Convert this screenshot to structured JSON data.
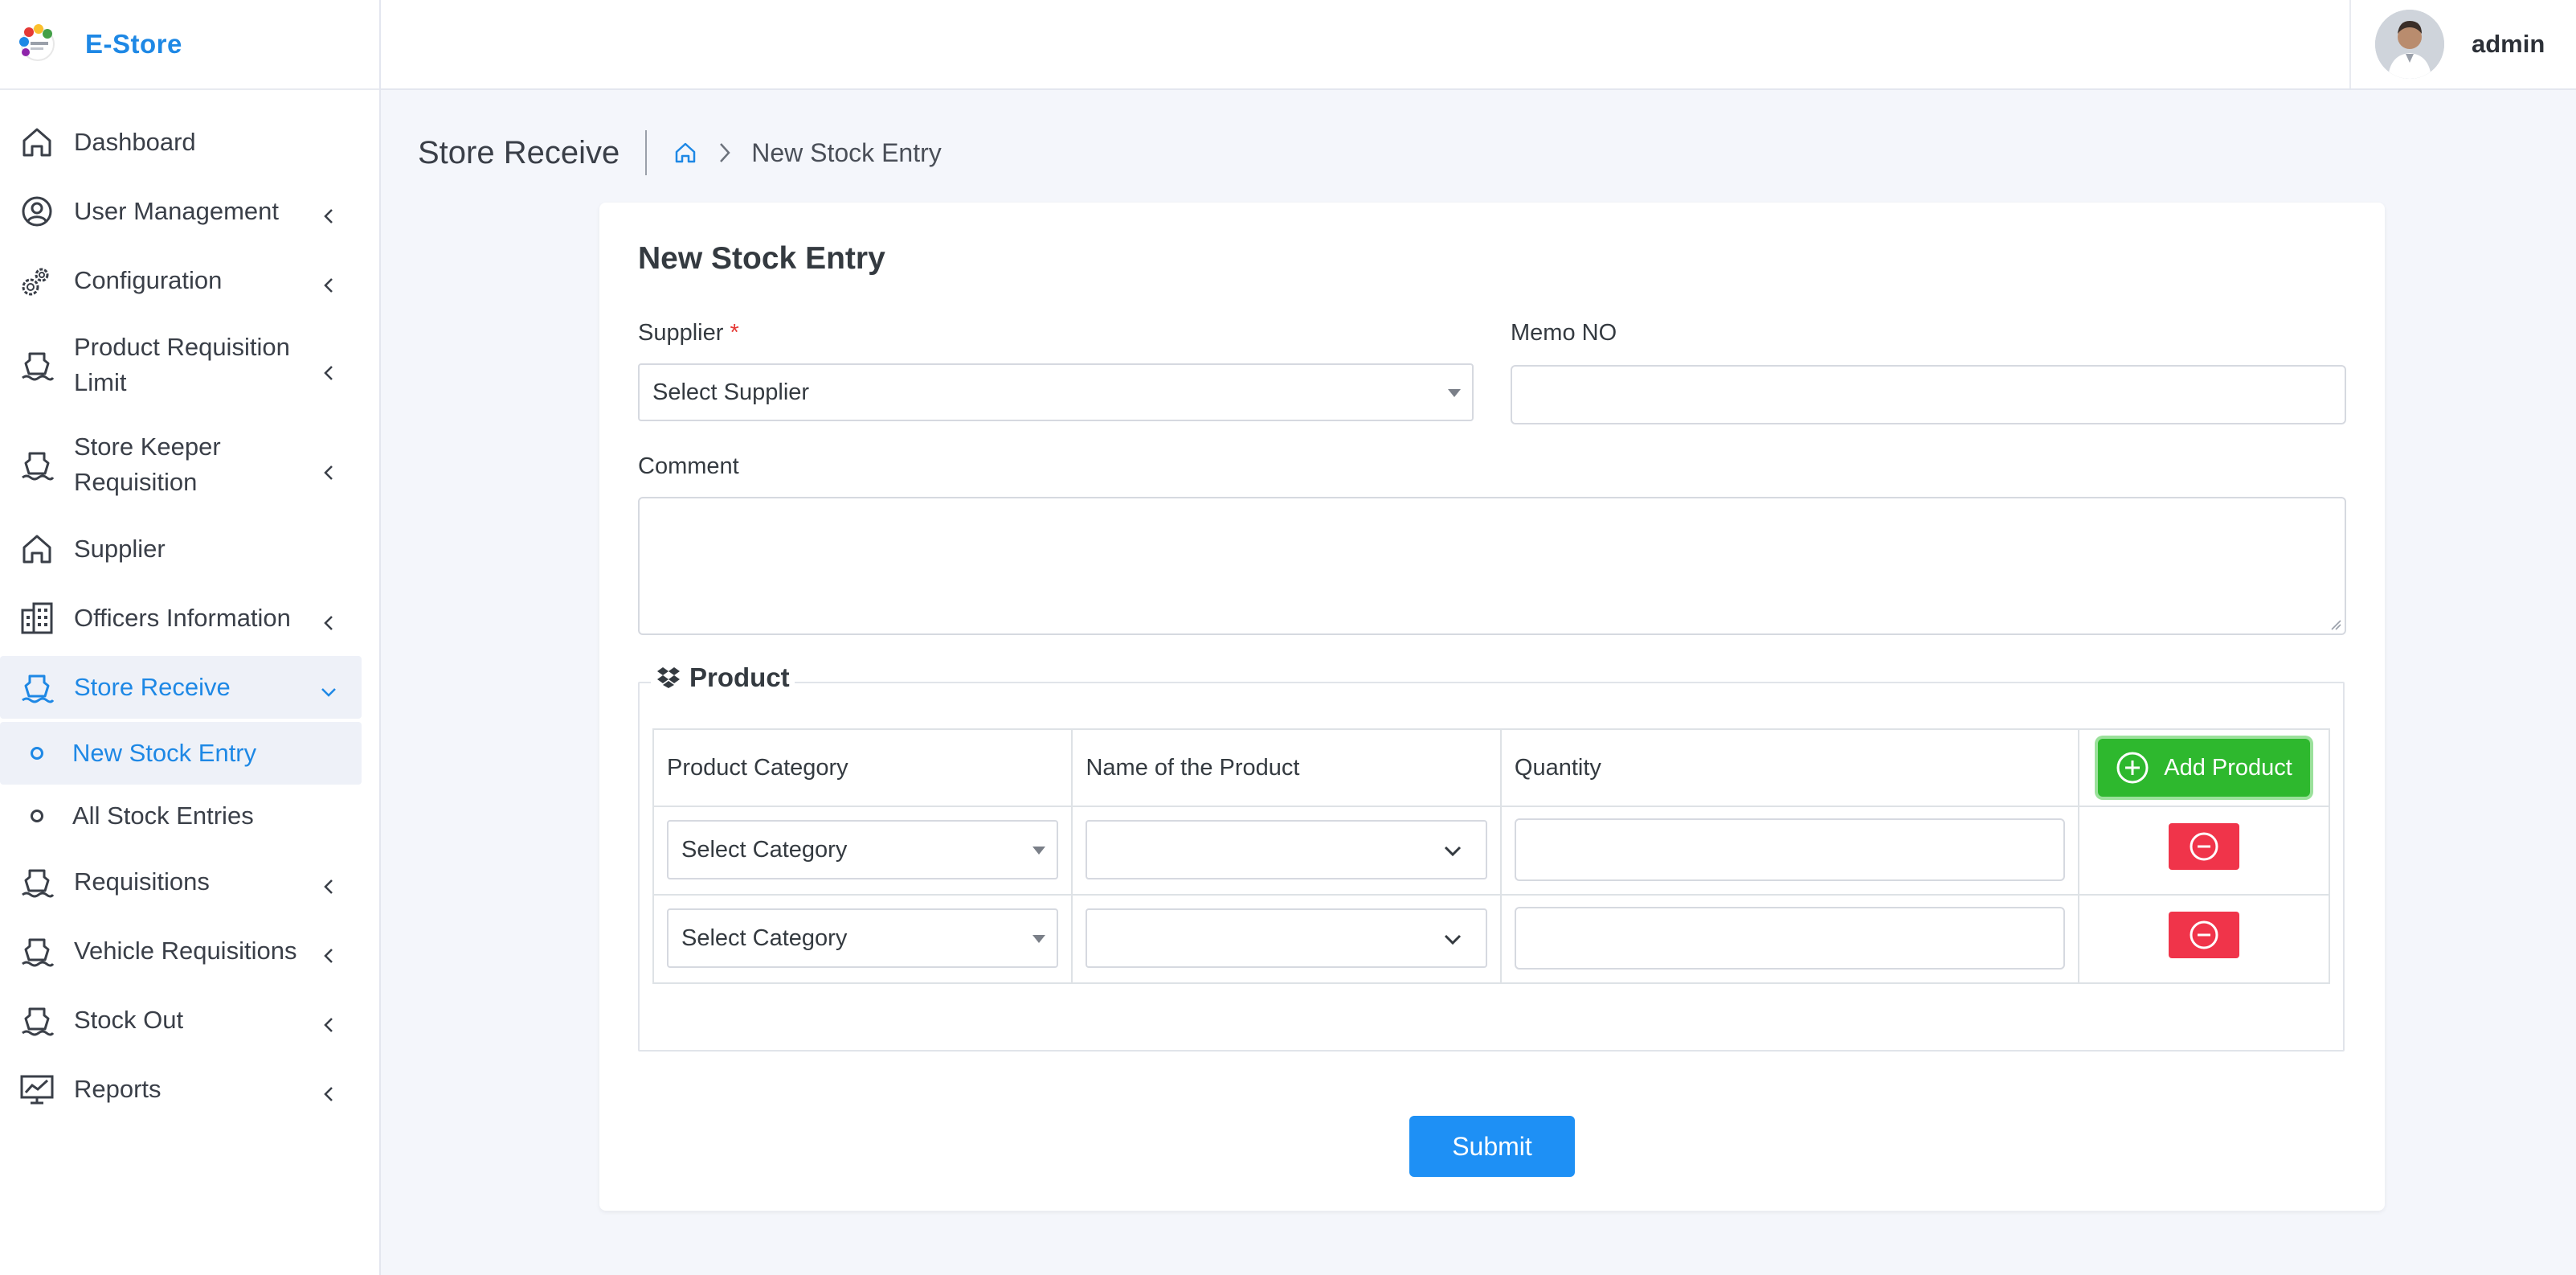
{
  "brand": {
    "name": "E-Store"
  },
  "sidebar": {
    "items": [
      {
        "label": "Dashboard"
      },
      {
        "label": "User Management"
      },
      {
        "label": "Configuration"
      },
      {
        "label": "Product Requisition Limit"
      },
      {
        "label": "Store Keeper Requisition"
      },
      {
        "label": "Supplier"
      },
      {
        "label": "Officers Information"
      },
      {
        "label": "Store Receive"
      },
      {
        "label": "Requisitions"
      },
      {
        "label": "Vehicle Requisitions"
      },
      {
        "label": "Stock Out"
      },
      {
        "label": "Reports"
      }
    ],
    "sub_items": [
      {
        "label": "New Stock Entry"
      },
      {
        "label": "All Stock Entries"
      }
    ]
  },
  "topbar": {
    "user_name": "admin"
  },
  "page": {
    "title": "Store Receive",
    "breadcrumb_current": "New Stock Entry"
  },
  "form": {
    "title": "New Stock Entry",
    "supplier_label": "Supplier",
    "required_mark": "*",
    "supplier_value": "Select Supplier",
    "memo_label": "Memo NO",
    "comment_label": "Comment",
    "product_legend": "Product",
    "columns": [
      "Product Category",
      "Name of the Product",
      "Quantity"
    ],
    "add_product_label": "Add Product",
    "rows": [
      {
        "category": "Select Category",
        "product": "",
        "quantity": ""
      },
      {
        "category": "Select Category",
        "product": "",
        "quantity": ""
      }
    ],
    "submit_label": "Submit"
  },
  "colors": {
    "accent": "#1e88e5",
    "add_button": "#2eb82e",
    "remove_button": "#f0344a",
    "submit_button": "#1e90f5"
  }
}
